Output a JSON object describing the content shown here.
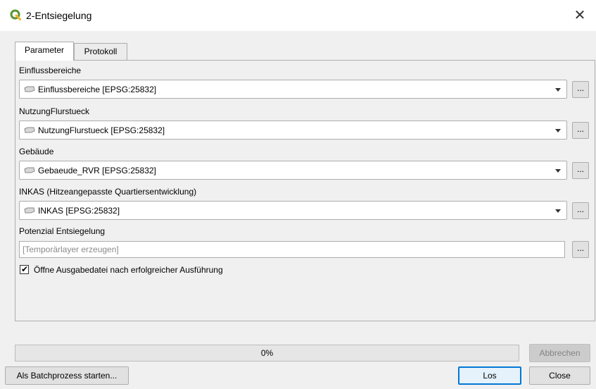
{
  "window": {
    "title": "2-Entsiegelung",
    "close_symbol": "✕",
    "icon": "qgis-logo-icon",
    "accent_color": "#589632"
  },
  "tabs": [
    {
      "label": "Parameter",
      "active": true
    },
    {
      "label": "Protokoll",
      "active": false
    }
  ],
  "params": [
    {
      "label": "Einflussbereiche",
      "value": "Einflussbereiche [EPSG:25832]"
    },
    {
      "label": "NutzungFlurstueck",
      "value": "NutzungFlurstueck [EPSG:25832]"
    },
    {
      "label": "Gebäude",
      "value": "Gebaeude_RVR [EPSG:25832]"
    },
    {
      "label": "INKAS (Hitzeangepasste Quartiersentwicklung)",
      "value": "INKAS [EPSG:25832]"
    }
  ],
  "browse_label": "...",
  "output": {
    "label": "Potenzial Entsiegelung",
    "placeholder": "[Temporärlayer erzeugen]",
    "value": ""
  },
  "open_output": {
    "label": "Öffne Ausgabedatei nach erfolgreicher Ausführung",
    "checked": true,
    "check_symbol": "✔"
  },
  "progress": {
    "percent": 0,
    "text": "0%"
  },
  "buttons": {
    "cancel": "Abbrechen",
    "batch": "Als Batchprozess starten...",
    "run": "Los",
    "close": "Close"
  }
}
